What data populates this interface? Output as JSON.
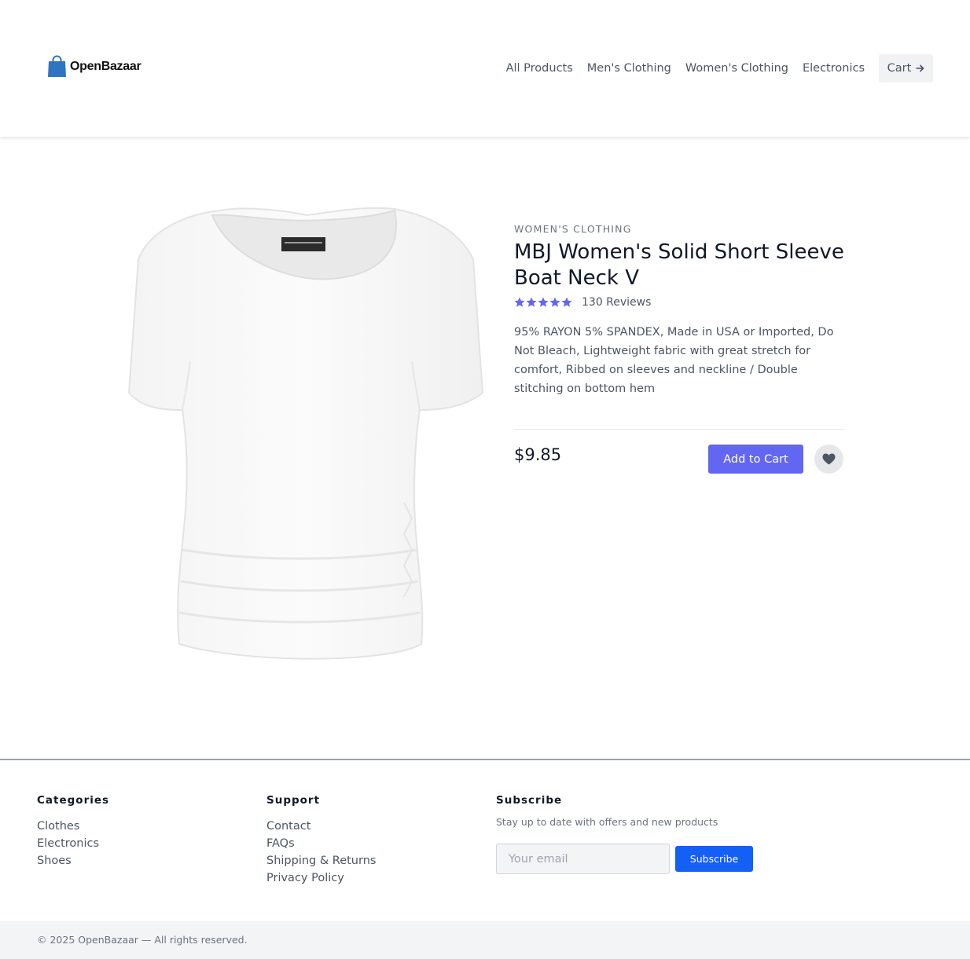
{
  "brand": {
    "name": "OpenBazaar",
    "color": "#2f74c0"
  },
  "nav": {
    "links": [
      "All Products",
      "Men's Clothing",
      "Women's Clothing",
      "Electronics"
    ],
    "cart_label": "Cart",
    "cart_icon": "arrow-right-icon"
  },
  "product": {
    "category": "Women's Clothing",
    "title": "MBJ Women's Solid Short Sleeve Boat Neck V",
    "rating_stars": 5,
    "reviews_label": "130 Reviews",
    "description": "95% RAYON 5% SPANDEX, Made in USA or Imported, Do Not Bleach, Lightweight fabric with great stretch for comfort, Ribbed on sleeves and neckline / Double stitching on bottom hem",
    "price": "$9.85",
    "add_to_cart_label": "Add to Cart",
    "favorite_icon": "heart-icon",
    "accent_color": "#6366f1"
  },
  "footer": {
    "categories": {
      "heading": "Categories",
      "links": [
        "Clothes",
        "Electronics",
        "Shoes"
      ]
    },
    "support": {
      "heading": "Support",
      "links": [
        "Contact",
        "FAQs",
        "Shipping & Returns",
        "Privacy Policy"
      ]
    },
    "subscribe": {
      "heading": "Subscribe",
      "text": "Stay up to date with offers and new products",
      "email_placeholder": "Your email",
      "button_label": "Subscribe",
      "button_color": "#1460f5"
    },
    "copyright": "© 2025 OpenBazaar — All rights reserved."
  }
}
